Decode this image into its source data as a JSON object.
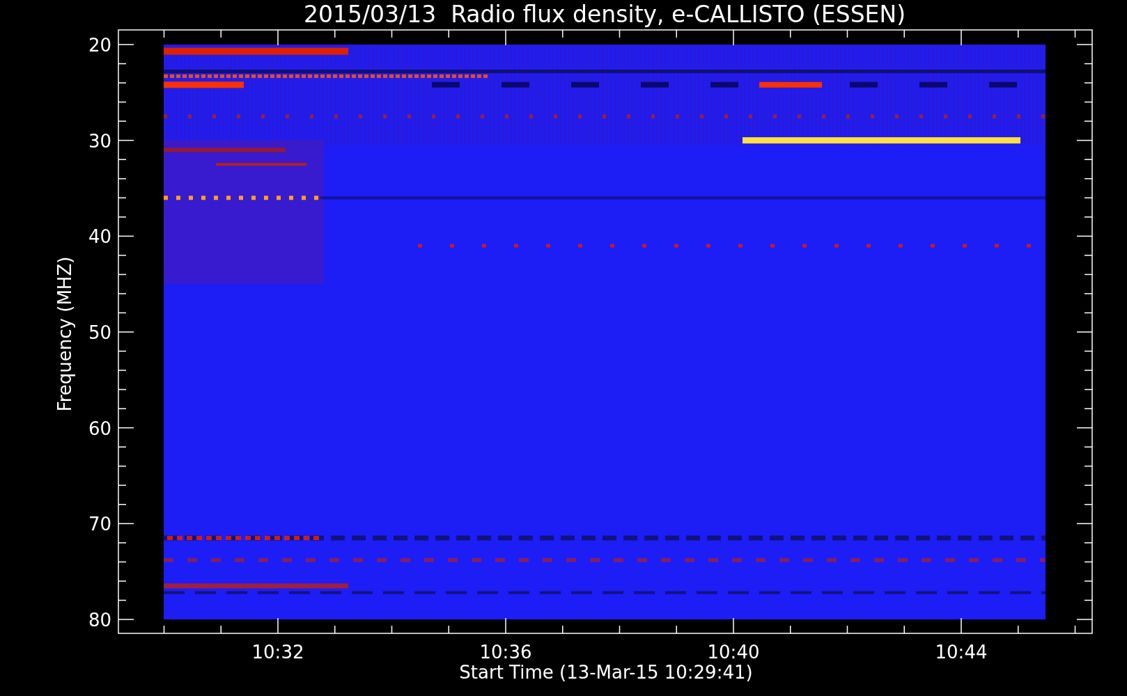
{
  "title": "2015/03/13  Radio flux density, e-CALLISTO (ESSEN)",
  "y_axis": {
    "label": "Frequency (MHZ)",
    "ticks": [
      "20",
      "30",
      "40",
      "50",
      "60",
      "70",
      "80"
    ]
  },
  "x_axis": {
    "label": "Start Time (13-Mar-15 10:29:41)",
    "ticks": [
      "10:32",
      "10:36",
      "10:40",
      "10:44"
    ]
  }
}
